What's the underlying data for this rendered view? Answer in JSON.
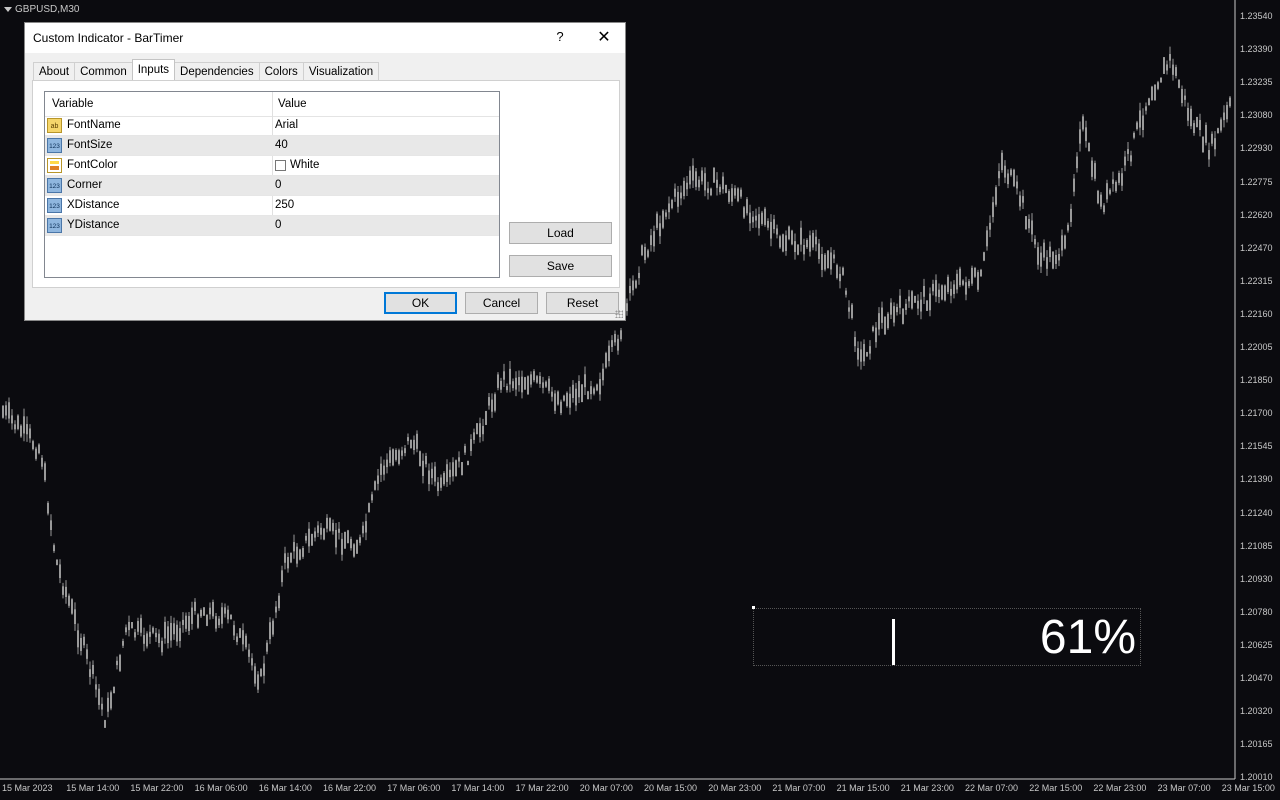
{
  "chart": {
    "symbol": "GBPUSD,M30",
    "price_labels": [
      "1.23540",
      "1.23390",
      "1.23235",
      "1.23080",
      "1.22930",
      "1.22775",
      "1.22620",
      "1.22470",
      "1.22315",
      "1.22160",
      "1.22005",
      "1.21850",
      "1.21700",
      "1.21545",
      "1.21390",
      "1.21240",
      "1.21085",
      "1.20930",
      "1.20780",
      "1.20625",
      "1.20470",
      "1.20320",
      "1.20165",
      "1.20010"
    ],
    "time_labels": [
      "15 Mar 2023",
      "15 Mar 14:00",
      "15 Mar 22:00",
      "16 Mar 06:00",
      "16 Mar 14:00",
      "16 Mar 22:00",
      "17 Mar 06:00",
      "17 Mar 14:00",
      "17 Mar 22:00",
      "20 Mar 07:00",
      "20 Mar 15:00",
      "20 Mar 23:00",
      "21 Mar 07:00",
      "21 Mar 15:00",
      "21 Mar 23:00",
      "22 Mar 07:00",
      "22 Mar 15:00",
      "22 Mar 23:00",
      "23 Mar 07:00",
      "23 Mar 15:00"
    ],
    "colors": {
      "background": "#0b0b0f",
      "candle": "#9a9a9a",
      "axis": "#c8c8c8",
      "text": "#ffffff"
    }
  },
  "bartimer": {
    "dots_top": ":      :      :           :           :      :      :",
    "dots_bottom": ". . . . . . . . . | . . . . . . :",
    "percent": "61%"
  },
  "dialog": {
    "title": "Custom Indicator - BarTimer",
    "help": "?",
    "close": "✕",
    "tabs": [
      "About",
      "Common",
      "Inputs",
      "Dependencies",
      "Colors",
      "Visualization"
    ],
    "active_tab": "Inputs",
    "grid_headers": {
      "variable": "Variable",
      "value": "Value"
    },
    "rows": [
      {
        "icon": "ab",
        "variable": "FontName",
        "value": "Arial"
      },
      {
        "icon": "123",
        "variable": "FontSize",
        "value": "40"
      },
      {
        "icon": "color",
        "variable": "FontColor",
        "value": "White"
      },
      {
        "icon": "123",
        "variable": "Corner",
        "value": "0"
      },
      {
        "icon": "123",
        "variable": "XDistance",
        "value": "250"
      },
      {
        "icon": "123",
        "variable": "YDistance",
        "value": "0"
      }
    ],
    "buttons": {
      "load": "Load",
      "save": "Save",
      "ok": "OK",
      "cancel": "Cancel",
      "reset": "Reset"
    }
  }
}
